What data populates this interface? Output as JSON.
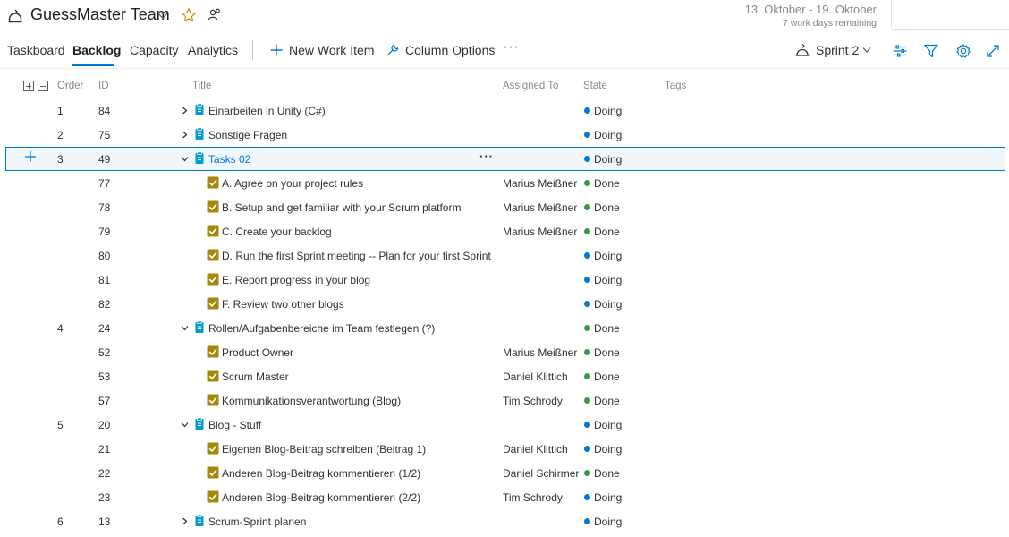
{
  "header": {
    "team_name": "GuessMaster Team",
    "sprint_dates": "13. Oktober - 19. Oktober",
    "work_days_remaining": "7 work days remaining"
  },
  "tabs": [
    {
      "label": "Taskboard",
      "active": false
    },
    {
      "label": "Backlog",
      "active": true
    },
    {
      "label": "Capacity",
      "active": false
    },
    {
      "label": "Analytics",
      "active": false
    }
  ],
  "toolbar": {
    "new_work_item": "New Work Item",
    "column_options": "Column Options",
    "more": "···",
    "sprint_label": "Sprint 2"
  },
  "columns": {
    "order": "Order",
    "id": "ID",
    "title": "Title",
    "assigned_to": "Assigned To",
    "state": "State",
    "tags": "Tags"
  },
  "colors": {
    "accent": "#0078d4",
    "doing": "#0078d4",
    "done": "#339947",
    "backlog_item": "#009ccc",
    "task": "#a4880a"
  },
  "rows": [
    {
      "order": "1",
      "id": "84",
      "title": "Einarbeiten in Unity (C#)",
      "type": "pbi",
      "level": 0,
      "twisty": "collapsed",
      "assigned": "",
      "state": "Doing"
    },
    {
      "order": "2",
      "id": "75",
      "title": "Sonstige Fragen",
      "type": "pbi",
      "level": 0,
      "twisty": "collapsed",
      "assigned": "",
      "state": "Doing"
    },
    {
      "order": "3",
      "id": "49",
      "title": "Tasks 02",
      "type": "pbi",
      "level": 0,
      "twisty": "expanded",
      "assigned": "",
      "state": "Doing",
      "selected": true
    },
    {
      "order": "",
      "id": "77",
      "title": "A. Agree on your project rules",
      "type": "task",
      "level": 1,
      "assigned": "Marius Meißner",
      "state": "Done"
    },
    {
      "order": "",
      "id": "78",
      "title": "B. Setup and get familiar with your Scrum platform",
      "type": "task",
      "level": 1,
      "assigned": "Marius Meißner",
      "state": "Done"
    },
    {
      "order": "",
      "id": "79",
      "title": "C. Create your backlog",
      "type": "task",
      "level": 1,
      "assigned": "Marius Meißner",
      "state": "Done"
    },
    {
      "order": "",
      "id": "80",
      "title": "D. Run the first Sprint meeting -- Plan for your first Sprint",
      "type": "task",
      "level": 1,
      "assigned": "",
      "state": "Doing"
    },
    {
      "order": "",
      "id": "81",
      "title": "E. Report progress in your blog",
      "type": "task",
      "level": 1,
      "assigned": "",
      "state": "Doing"
    },
    {
      "order": "",
      "id": "82",
      "title": "F. Review two other blogs",
      "type": "task",
      "level": 1,
      "assigned": "",
      "state": "Doing"
    },
    {
      "order": "4",
      "id": "24",
      "title": "Rollen/Aufgabenbereiche im Team festlegen (?)",
      "type": "pbi",
      "level": 0,
      "twisty": "expanded",
      "assigned": "",
      "state": "Done"
    },
    {
      "order": "",
      "id": "52",
      "title": "Product Owner",
      "type": "task",
      "level": 1,
      "assigned": "Marius Meißner",
      "state": "Done"
    },
    {
      "order": "",
      "id": "53",
      "title": "Scrum Master",
      "type": "task",
      "level": 1,
      "assigned": "Daniel Klittich",
      "state": "Done"
    },
    {
      "order": "",
      "id": "57",
      "title": "Kommunikationsverantwortung (Blog)",
      "type": "task",
      "level": 1,
      "assigned": "Tim Schrody",
      "state": "Done"
    },
    {
      "order": "5",
      "id": "20",
      "title": "Blog - Stuff",
      "type": "pbi",
      "level": 0,
      "twisty": "expanded",
      "assigned": "",
      "state": "Doing"
    },
    {
      "order": "",
      "id": "21",
      "title": "Eigenen Blog-Beitrag schreiben (Beitrag 1)",
      "type": "task",
      "level": 1,
      "assigned": "Daniel Klittich",
      "state": "Doing"
    },
    {
      "order": "",
      "id": "22",
      "title": "Anderen Blog-Beitrag kommentieren (1/2)",
      "type": "task",
      "level": 1,
      "assigned": "Daniel Schirmer",
      "state": "Done"
    },
    {
      "order": "",
      "id": "23",
      "title": "Anderen Blog-Beitrag kommentieren (2/2)",
      "type": "task",
      "level": 1,
      "assigned": "Tim Schrody",
      "state": "Doing"
    },
    {
      "order": "6",
      "id": "13",
      "title": "Scrum-Sprint planen",
      "type": "pbi",
      "level": 0,
      "twisty": "collapsed",
      "assigned": "",
      "state": "Doing"
    }
  ]
}
